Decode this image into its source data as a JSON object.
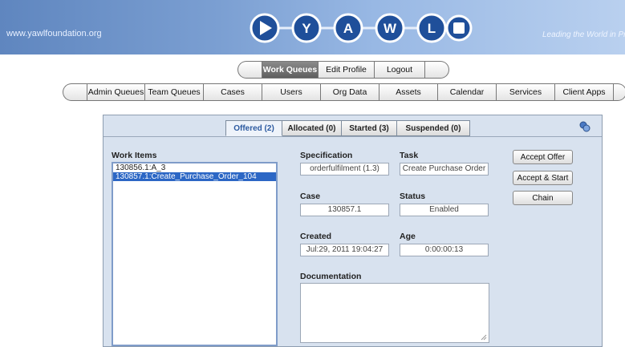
{
  "header": {
    "site": "www.yawlfoundation.org",
    "tagline": "Leading the World in Pro",
    "logo_letters": [
      "Y",
      "A",
      "W",
      "L"
    ]
  },
  "topnav": {
    "items": [
      {
        "label": "Work Queues",
        "active": true
      },
      {
        "label": "Edit Profile",
        "active": false
      },
      {
        "label": "Logout",
        "active": false
      }
    ]
  },
  "secnav": {
    "items": [
      {
        "label": "Admin Queues"
      },
      {
        "label": "Team Queues"
      },
      {
        "label": "Cases"
      },
      {
        "label": "Users"
      },
      {
        "label": "Org Data"
      },
      {
        "label": "Assets"
      },
      {
        "label": "Calendar"
      },
      {
        "label": "Services"
      },
      {
        "label": "Client Apps"
      }
    ]
  },
  "tabs": [
    {
      "label": "Offered (2)",
      "active": true
    },
    {
      "label": "Allocated (0)",
      "active": false
    },
    {
      "label": "Started (3)",
      "active": false
    },
    {
      "label": "Suspended (0)",
      "active": false
    }
  ],
  "work_items": {
    "label": "Work Items",
    "items": [
      {
        "text": "130856.1:A_3",
        "selected": false
      },
      {
        "text": "130857.1:Create_Purchase_Order_104",
        "selected": true
      }
    ]
  },
  "details": {
    "specification_label": "Specification",
    "specification": "orderfulfilment (1.3)",
    "task_label": "Task",
    "task": "Create Purchase Order",
    "case_label": "Case",
    "case": "130857.1",
    "status_label": "Status",
    "status": "Enabled",
    "created_label": "Created",
    "created": "Jul:29, 2011 19:04:27",
    "age_label": "Age",
    "age": "0:00:00:13",
    "documentation_label": "Documentation",
    "documentation": ""
  },
  "actions": {
    "accept_offer": "Accept Offer",
    "accept_start": "Accept & Start",
    "chain": "Chain"
  },
  "colors": {
    "selected_row": "#2c67c5",
    "active_tab_text": "#2c5aa0",
    "panel_bg": "#d8e2ef"
  }
}
